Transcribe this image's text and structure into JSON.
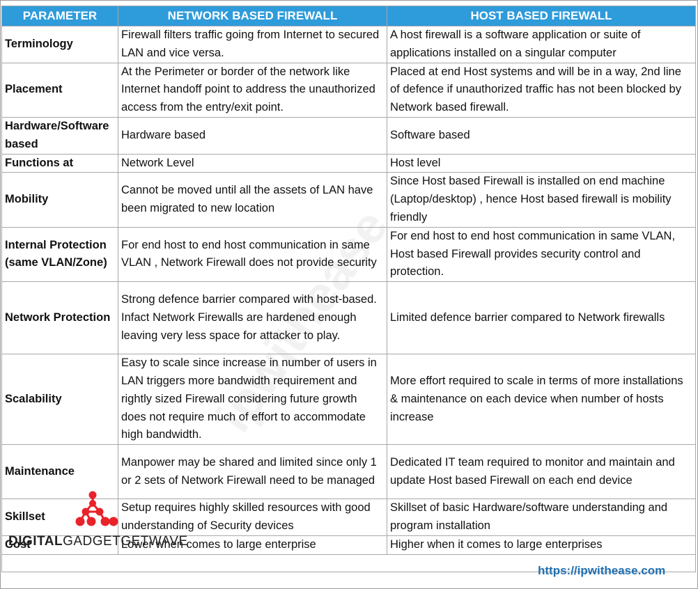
{
  "headers": [
    "PARAMETER",
    "NETWORK BASED FIREWALL",
    "HOST BASED FIREWALL"
  ],
  "rows": [
    {
      "parameter": "Terminology",
      "network": "Firewall filters traffic going from Internet to secured LAN and vice versa.",
      "host": "A host firewall is a software application or suite of applications installed on a singular computer"
    },
    {
      "parameter": "Placement",
      "network": "At the Perimeter or border of the network like Internet handoff point to address the unauthorized access from the entry/exit point.",
      "host": "Placed at end Host systems and will be in a way, 2nd line of defence if unauthorized traffic has not been blocked by Network based firewall."
    },
    {
      "parameter": "Hardware/Software based",
      "network": "Hardware based",
      "host": "Software based"
    },
    {
      "parameter": "Functions at",
      "network": "Network Level",
      "host": "Host level"
    },
    {
      "parameter": "Mobility",
      "network": "Cannot be moved until all the assets of LAN have been migrated to new location",
      "host": "Since Host based Firewall is installed on end machine (Laptop/desktop) , hence Host based firewall is mobility friendly"
    },
    {
      "parameter": "Internal Protection (same VLAN/Zone)",
      "network": "For end host to end host communication in same VLAN , Network Firewall does not provide security",
      "host": "For end host to end host communication in same VLAN, Host based Firewall provides security control and protection."
    },
    {
      "parameter": "Network Protection",
      "network": "Strong defence barrier compared with host-based. Infact Network Firewalls are hardened enough leaving very less space for attacker to play.",
      "host": "Limited defence barrier compared to Network firewalls"
    },
    {
      "parameter": "Scalability",
      "network": "Easy to scale since increase in number of users in LAN triggers more bandwidth requirement and rightly sized Firewall considering future growth does not require much of effort to accommodate high bandwidth.",
      "host": "More effort required to scale in terms of more installations & maintenance on each device when number of hosts increase"
    },
    {
      "parameter": "Maintenance",
      "network": "Manpower may be shared and limited since only 1 or 2 sets of Network Firewall need to be managed",
      "host": "Dedicated IT team required to monitor and maintain and update Host based Firewall on each end device"
    },
    {
      "parameter": "Skillset",
      "network": "Setup requires highly skilled resources with good understanding of Security devices",
      "host": "Skillset of basic Hardware/software understanding and program installation"
    },
    {
      "parameter": "Cost",
      "network": "Lower when comes to large enterprise",
      "host": "Higher when it comes to large enterprises"
    }
  ],
  "footer_url": "https://ipwithease.com",
  "watermark": "ipwithease",
  "logo": {
    "bold": "DIGITAL",
    "light": "GADGETGETWAVE",
    "color": "#e8232a"
  },
  "colors": {
    "header_bg": "#2e9bdb",
    "url": "#1f6fb2"
  }
}
